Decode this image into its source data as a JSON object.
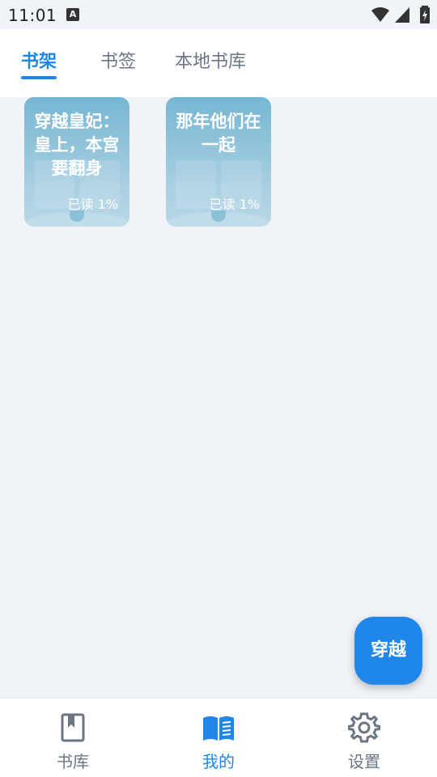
{
  "status_bar": {
    "time": "11:01",
    "notification_icon": "A"
  },
  "tabs": [
    {
      "label": "书架",
      "active": true
    },
    {
      "label": "书签",
      "active": false
    },
    {
      "label": "本地书库",
      "active": false
    }
  ],
  "books": [
    {
      "title": "穿越皇妃：皇上，本宫要翻身",
      "progress_label": "已读 1%",
      "progress": 1
    },
    {
      "title": "那年他们在一起",
      "progress_label": "已读 1%",
      "progress": 1
    }
  ],
  "fab": {
    "label": "穿越"
  },
  "bottom_nav": [
    {
      "label": "书库",
      "icon": "bookmark-book-icon",
      "active": false
    },
    {
      "label": "我的",
      "icon": "open-book-icon",
      "active": true
    },
    {
      "label": "设置",
      "icon": "gear-icon",
      "active": false
    }
  ],
  "colors": {
    "accent": "#1f87ea",
    "background": "#f0f3f8",
    "inactive_text": "#6b7685",
    "book_cover": "#8fc2d9"
  }
}
